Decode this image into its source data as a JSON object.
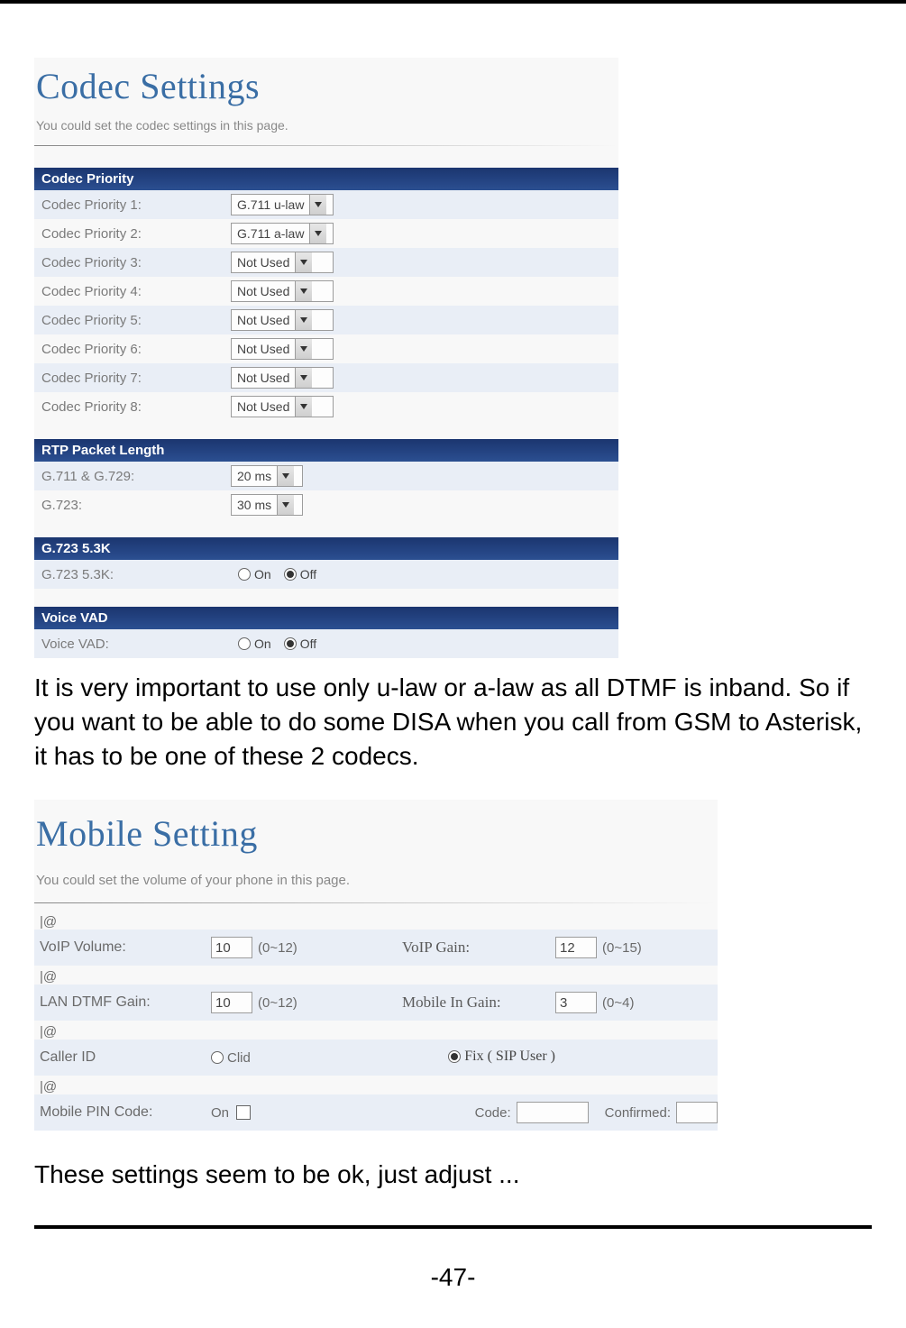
{
  "doc": {
    "paragraph1": "It is very important to use only u-law or a-law as all DTMF is inband. So if you want to be able to do some DISA when you call from GSM to Asterisk, it has to be one of these 2 codecs.",
    "paragraph2": "These settings seem to be ok, just adjust ...",
    "page_number": "-47-"
  },
  "codec": {
    "title": "Codec Settings",
    "subtitle": "You could set the codec settings in this page.",
    "priority_header": "Codec Priority",
    "priority": [
      {
        "label": "Codec Priority 1:",
        "value": "G.711 u-law"
      },
      {
        "label": "Codec Priority 2:",
        "value": "G.711 a-law"
      },
      {
        "label": "Codec Priority 3:",
        "value": "Not Used"
      },
      {
        "label": "Codec Priority 4:",
        "value": "Not Used"
      },
      {
        "label": "Codec Priority 5:",
        "value": "Not Used"
      },
      {
        "label": "Codec Priority 6:",
        "value": "Not Used"
      },
      {
        "label": "Codec Priority 7:",
        "value": "Not Used"
      },
      {
        "label": "Codec Priority 8:",
        "value": "Not Used"
      }
    ],
    "rtp_header": "RTP Packet Length",
    "rtp": [
      {
        "label": "G.711 & G.729:",
        "value": "20 ms"
      },
      {
        "label": "G.723:",
        "value": "30 ms"
      }
    ],
    "g723_header": "G.723 5.3K",
    "g723_label": "G.723 5.3K:",
    "on": "On",
    "off": "Off",
    "vad_header": "Voice VAD",
    "vad_label": "Voice VAD:"
  },
  "mobile": {
    "title": "Mobile Setting",
    "subtitle": "You could set the volume of your phone in this page.",
    "tag": "|@",
    "voip_volume_label": "VoIP Volume:",
    "voip_volume_value": "10",
    "voip_volume_range": "(0~12)",
    "voip_gain_label": "VoIP Gain:",
    "voip_gain_value": "12",
    "voip_gain_range": "(0~15)",
    "lan_dtmf_label": "LAN DTMF Gain:",
    "lan_dtmf_value": "10",
    "lan_dtmf_range": "(0~12)",
    "mobile_in_label": "Mobile In Gain:",
    "mobile_in_value": "3",
    "mobile_in_range": "(0~4)",
    "callerid_label": "Caller ID",
    "clid": "Clid",
    "fix": "Fix ( SIP User )",
    "pin_label": "Mobile PIN Code:",
    "on_cb": "On",
    "code_label": "Code:",
    "confirmed_label": "Confirmed:"
  }
}
